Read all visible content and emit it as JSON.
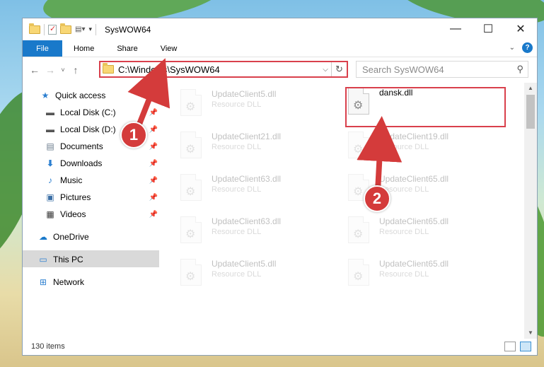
{
  "window": {
    "title": "SysWOW64",
    "controls": {
      "minimize": "—",
      "maximize": "☐",
      "close": "✕"
    }
  },
  "ribbon": {
    "tabs": [
      "File",
      "Home",
      "Share",
      "View"
    ],
    "help_label": "?"
  },
  "address_bar": {
    "path": "C:\\Windows\\SysWOW64"
  },
  "search": {
    "placeholder": "Search SysWOW64"
  },
  "sidebar": {
    "items": [
      {
        "label": "Quick access",
        "icon": "star-icon"
      },
      {
        "label": "Local Disk (C:)",
        "icon": "drive-icon"
      },
      {
        "label": "Local Disk (D:)",
        "icon": "drive-icon"
      },
      {
        "label": "Documents",
        "icon": "documents-icon"
      },
      {
        "label": "Downloads",
        "icon": "download-icon"
      },
      {
        "label": "Music",
        "icon": "music-icon"
      },
      {
        "label": "Pictures",
        "icon": "pictures-icon"
      },
      {
        "label": "Videos",
        "icon": "videos-icon"
      },
      {
        "label": "OneDrive",
        "icon": "cloud-icon"
      },
      {
        "label": "This PC",
        "icon": "computer-icon",
        "selected": true
      },
      {
        "label": "Network",
        "icon": "network-icon"
      }
    ]
  },
  "files": [
    {
      "name": "UpdateClient5.dll",
      "type": "Resource DLL"
    },
    {
      "name": "dansk.dll",
      "type": ""
    },
    {
      "name": "UpdateClient21.dll",
      "type": "Resource DLL"
    },
    {
      "name": "UpdateClient19.dll",
      "type": "Resource DLL"
    },
    {
      "name": "UpdateClient63.dll",
      "type": "Resource DLL"
    },
    {
      "name": "UpdateClient65.dll",
      "type": "Resource DLL"
    },
    {
      "name": "UpdateClient63.dll",
      "type": "Resource DLL"
    },
    {
      "name": "UpdateClient65.dll",
      "type": "Resource DLL"
    },
    {
      "name": "UpdateClient5.dll",
      "type": "Resource DLL"
    },
    {
      "name": "UpdateClient65.dll",
      "type": "Resource DLL"
    }
  ],
  "status": {
    "item_count": "130 items"
  },
  "annotations": {
    "step1": "1",
    "step2": "2",
    "highlight_color": "#d9404c"
  }
}
